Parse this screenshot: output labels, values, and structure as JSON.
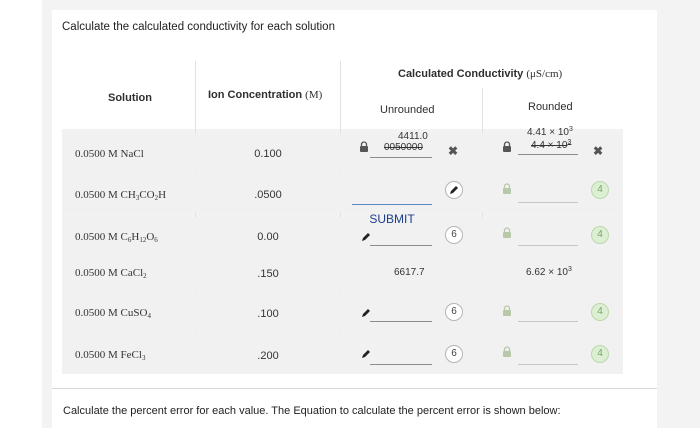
{
  "question": "Calculate the calculated conductivity for each solution",
  "headers": {
    "solution": "Solution",
    "ion_conc_prefix": "Ion Concentration ",
    "ion_conc_unit": "(M)",
    "calc_cond_prefix": "Calculated Conductivity ",
    "calc_cond_unit": "(μS/cm)",
    "unrounded": "Unrounded",
    "rounded": "Rounded"
  },
  "rows": [
    {
      "conc": "0.0500 M",
      "name": "NaCl",
      "ion": "0.100",
      "unrounded_value": "4411.0",
      "unrounded_prev": "0050000",
      "unrounded_mark": "✖",
      "rounded_value_base": "4.41 × 10",
      "rounded_value_exp": "3",
      "rounded_prev_base": "4.4 × 10",
      "rounded_prev_exp": "3",
      "rounded_mark": "✖"
    },
    {
      "conc": "0.0500 M",
      "name": "CH3CO2H",
      "ion": ".0500",
      "rounded_badge": "4"
    },
    {
      "conc": "0.0500 M",
      "name": "C6H12O6",
      "ion": "0.00",
      "unrounded_badge": "6",
      "rounded_badge": "4"
    },
    {
      "conc": "0.0500 M",
      "name": "CaCl2",
      "ion": ".150",
      "unrounded_value": "6617.7",
      "rounded_value_base": "6.62 × 10",
      "rounded_value_exp": "3"
    },
    {
      "conc": "0.0500 M",
      "name": "CuSO4",
      "ion": ".100",
      "unrounded_badge": "6",
      "rounded_badge": "4"
    },
    {
      "conc": "0.0500 M",
      "name": "FeCl3",
      "ion": ".200",
      "unrounded_badge": "6",
      "rounded_badge": "4"
    }
  ],
  "submit_label": "SUBMIT",
  "footer": "Calculate the percent error for each value. The Equation to calculate the percent error is shown below:",
  "icons": [
    "lock-icon",
    "pencil-icon",
    "x-icon"
  ],
  "colors": {
    "accent": "#1a3f8f",
    "badge_green": "#dcefd2",
    "link_line": "#5b87c5"
  }
}
